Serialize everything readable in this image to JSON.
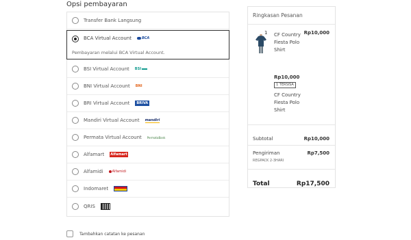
{
  "payment": {
    "heading": "Opsi pembayaran",
    "options": [
      {
        "label": "Transfer Bank Langsung",
        "logo": "",
        "selected": false
      },
      {
        "label": "BCA Virtual Account",
        "logo": "BCA",
        "selected": true,
        "description": "Pembayaran melalui BCA Virtual Account."
      },
      {
        "label": "BSI Virtual Account",
        "logo": "BSI",
        "selected": false
      },
      {
        "label": "BNI Virtual Account",
        "logo": "BNI",
        "selected": false
      },
      {
        "label": "BRI Virtual Account",
        "logo": "BRIVA",
        "selected": false
      },
      {
        "label": "Mandiri Virtual Account",
        "logo": "mandiri",
        "selected": false
      },
      {
        "label": "Permata Virtual Account",
        "logo": "PermataBank",
        "selected": false
      },
      {
        "label": "Alfamart",
        "logo": "Alfamart",
        "selected": false
      },
      {
        "label": "Alfamidi",
        "logo": "Alfamidi",
        "selected": false
      },
      {
        "label": "Indomaret",
        "logo": "",
        "selected": false
      },
      {
        "label": "QRIS",
        "logo": "",
        "selected": false
      }
    ]
  },
  "note": {
    "label": "Tambahkan catatan ke pesanan",
    "checked": false
  },
  "summary": {
    "title": "Ringkasan Pesanan",
    "item": {
      "quantity": "1",
      "name": "CF Country Fiesta Polo Shirt",
      "price": "Rp10,000",
      "unit_price": "Rp10,000",
      "stock_badge": "1 TERSISA",
      "variant": "CF Country Fiesta Polo Shirt"
    },
    "subtotal_label": "Subtotal",
    "subtotal_value": "Rp10,000",
    "shipping_label": "Pengiriman",
    "shipping_value": "Rp7,500",
    "shipping_service": "REGPACK 2-3HARI",
    "total_label": "Total",
    "total_value": "Rp17,500"
  }
}
